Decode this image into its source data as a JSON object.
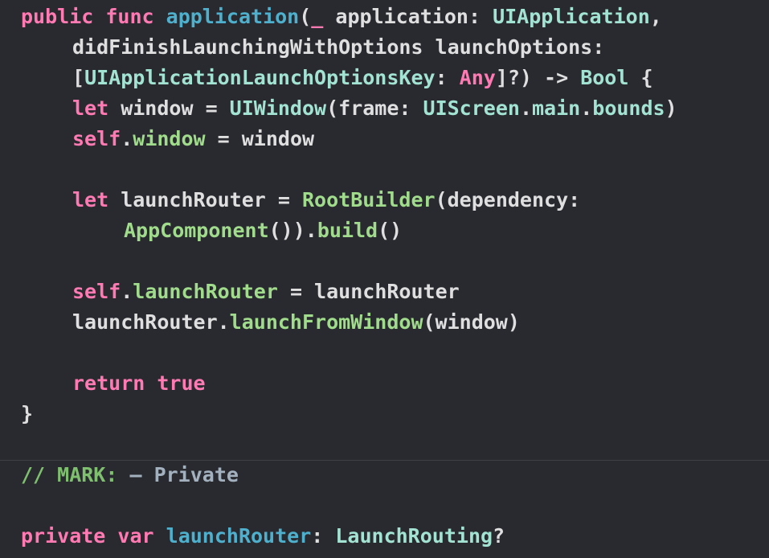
{
  "colors": {
    "background": "#292a30",
    "plain": "#dfdfe0",
    "keyword": "#ff7ab2",
    "declaration": "#4eb0cc",
    "type": "#a3e3d4",
    "project_type": "#a0dc8c",
    "comment": "#7fc06f",
    "mark_text": "#a3b1bf",
    "divider": "#3e3f46"
  },
  "code_lines": [
    {
      "indent": 0,
      "tokens": [
        {
          "t": "public",
          "k": "keyword"
        },
        {
          "t": " ",
          "k": "plain"
        },
        {
          "t": "func",
          "k": "keyword"
        },
        {
          "t": " ",
          "k": "plain"
        },
        {
          "t": "application",
          "k": "declaration"
        },
        {
          "t": "(",
          "k": "plain"
        },
        {
          "t": "_",
          "k": "keyword"
        },
        {
          "t": " application: ",
          "k": "plain"
        },
        {
          "t": "UIApplication",
          "k": "type"
        },
        {
          "t": ",",
          "k": "plain"
        }
      ]
    },
    {
      "indent": 1,
      "tokens": [
        {
          "t": "didFinishLaunchingWithOptions launchOptions:",
          "k": "plain"
        }
      ]
    },
    {
      "indent": 1,
      "tokens": [
        {
          "t": "[",
          "k": "plain"
        },
        {
          "t": "UIApplicationLaunchOptionsKey",
          "k": "type"
        },
        {
          "t": ": ",
          "k": "plain"
        },
        {
          "t": "Any",
          "k": "keyword"
        },
        {
          "t": "]?) -> ",
          "k": "plain"
        },
        {
          "t": "Bool",
          "k": "type"
        },
        {
          "t": " {",
          "k": "plain"
        }
      ]
    },
    {
      "indent": 1,
      "tokens": [
        {
          "t": "let",
          "k": "keyword"
        },
        {
          "t": " window = ",
          "k": "plain"
        },
        {
          "t": "UIWindow",
          "k": "type"
        },
        {
          "t": "(frame: ",
          "k": "plain"
        },
        {
          "t": "UIScreen",
          "k": "type"
        },
        {
          "t": ".",
          "k": "plain"
        },
        {
          "t": "main",
          "k": "type"
        },
        {
          "t": ".",
          "k": "plain"
        },
        {
          "t": "bounds",
          "k": "type"
        },
        {
          "t": ")",
          "k": "plain"
        }
      ]
    },
    {
      "indent": 1,
      "tokens": [
        {
          "t": "self",
          "k": "keyword"
        },
        {
          "t": ".",
          "k": "plain"
        },
        {
          "t": "window",
          "k": "project_type"
        },
        {
          "t": " = window",
          "k": "plain"
        }
      ]
    },
    {
      "indent": 0,
      "tokens": []
    },
    {
      "indent": 1,
      "tokens": [
        {
          "t": "let",
          "k": "keyword"
        },
        {
          "t": " launchRouter = ",
          "k": "plain"
        },
        {
          "t": "RootBuilder",
          "k": "project_type"
        },
        {
          "t": "(dependency:",
          "k": "plain"
        }
      ]
    },
    {
      "indent": 2,
      "tokens": [
        {
          "t": "AppComponent",
          "k": "project_type"
        },
        {
          "t": "()).",
          "k": "plain"
        },
        {
          "t": "build",
          "k": "project_type"
        },
        {
          "t": "()",
          "k": "plain"
        }
      ]
    },
    {
      "indent": 0,
      "tokens": []
    },
    {
      "indent": 1,
      "tokens": [
        {
          "t": "self",
          "k": "keyword"
        },
        {
          "t": ".",
          "k": "plain"
        },
        {
          "t": "launchRouter",
          "k": "project_type"
        },
        {
          "t": " = launchRouter",
          "k": "plain"
        }
      ]
    },
    {
      "indent": 1,
      "tokens": [
        {
          "t": "launchRouter.",
          "k": "plain"
        },
        {
          "t": "launchFromWindow",
          "k": "project_type"
        },
        {
          "t": "(window)",
          "k": "plain"
        }
      ]
    },
    {
      "indent": 0,
      "tokens": []
    },
    {
      "indent": 1,
      "tokens": [
        {
          "t": "return",
          "k": "keyword"
        },
        {
          "t": " ",
          "k": "plain"
        },
        {
          "t": "true",
          "k": "keyword"
        }
      ]
    },
    {
      "indent": 0,
      "tokens": [
        {
          "t": "}",
          "k": "plain"
        }
      ]
    },
    {
      "indent": 0,
      "tokens": []
    },
    {
      "indent": 0,
      "tokens": [
        {
          "t": "// MARK: ",
          "k": "comment"
        },
        {
          "t": "– Private",
          "k": "mark_text"
        }
      ]
    },
    {
      "indent": 0,
      "tokens": []
    },
    {
      "indent": 0,
      "tokens": [
        {
          "t": "private",
          "k": "keyword"
        },
        {
          "t": " ",
          "k": "plain"
        },
        {
          "t": "var",
          "k": "keyword"
        },
        {
          "t": " ",
          "k": "plain"
        },
        {
          "t": "launchRouter",
          "k": "declaration"
        },
        {
          "t": ": ",
          "k": "plain"
        },
        {
          "t": "LaunchRouting",
          "k": "type"
        },
        {
          "t": "?",
          "k": "plain"
        }
      ]
    }
  ]
}
